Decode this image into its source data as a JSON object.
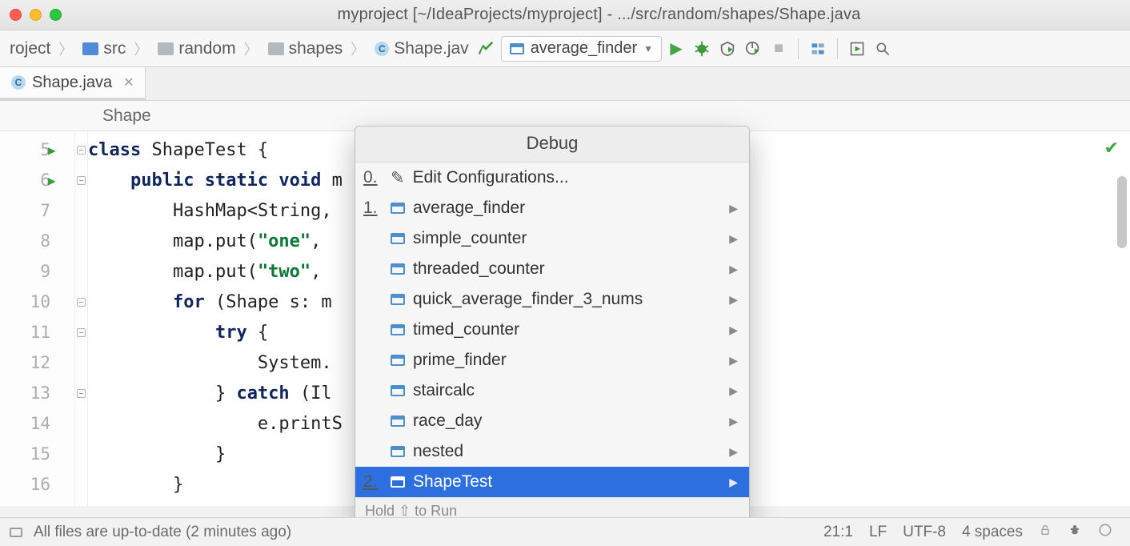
{
  "title": "myproject [~/IdeaProjects/myproject] - .../src/random/shapes/Shape.java",
  "breadcrumbs": {
    "items": [
      "roject",
      "src",
      "random",
      "shapes",
      "Shape.jav"
    ]
  },
  "run_config": {
    "selected": "average_finder"
  },
  "tab": {
    "name": "Shape.java"
  },
  "editor_crumb": "Shape",
  "gutter": {
    "lines": [
      "5",
      "6",
      "7",
      "8",
      "9",
      "10",
      "11",
      "12",
      "13",
      "14",
      "15",
      "16"
    ],
    "run_markers": [
      0,
      1
    ]
  },
  "code": {
    "lines": [
      {
        "indent": 0,
        "tokens": [
          {
            "t": "kw",
            "v": "class "
          },
          {
            "t": "plain",
            "v": "ShapeTest {"
          }
        ]
      },
      {
        "indent": 1,
        "tokens": [
          {
            "t": "kw",
            "v": "public static void "
          },
          {
            "t": "plain",
            "v": "m"
          }
        ]
      },
      {
        "indent": 2,
        "tokens": [
          {
            "t": "plain",
            "v": "HashMap<String,"
          }
        ]
      },
      {
        "indent": 2,
        "tokens": [
          {
            "t": "plain",
            "v": "map.put("
          },
          {
            "t": "str",
            "v": "\"one\""
          },
          {
            "t": "plain",
            "v": ", "
          }
        ]
      },
      {
        "indent": 2,
        "tokens": [
          {
            "t": "plain",
            "v": "map.put("
          },
          {
            "t": "str",
            "v": "\"two\""
          },
          {
            "t": "plain",
            "v": ", "
          }
        ]
      },
      {
        "indent": 2,
        "tokens": [
          {
            "t": "kw",
            "v": "for "
          },
          {
            "t": "plain",
            "v": "(Shape s: m"
          }
        ]
      },
      {
        "indent": 3,
        "tokens": [
          {
            "t": "kw",
            "v": "try "
          },
          {
            "t": "plain",
            "v": "{"
          }
        ]
      },
      {
        "indent": 4,
        "tokens": [
          {
            "t": "plain",
            "v": "System."
          }
        ]
      },
      {
        "indent": 3,
        "tokens": [
          {
            "t": "plain",
            "v": "} "
          },
          {
            "t": "kw",
            "v": "catch "
          },
          {
            "t": "plain",
            "v": "(Il"
          }
        ]
      },
      {
        "indent": 4,
        "tokens": [
          {
            "t": "plain",
            "v": "e.printS"
          }
        ]
      },
      {
        "indent": 3,
        "tokens": [
          {
            "t": "plain",
            "v": "}"
          }
        ]
      },
      {
        "indent": 2,
        "tokens": [
          {
            "t": "plain",
            "v": "}"
          }
        ]
      }
    ]
  },
  "popup": {
    "title": "Debug",
    "edit_label": "Edit Configurations...",
    "edit_num": "0.",
    "items": [
      {
        "num": "1.",
        "label": "average_finder",
        "selected": false
      },
      {
        "num": "",
        "label": "simple_counter",
        "selected": false
      },
      {
        "num": "",
        "label": "threaded_counter",
        "selected": false
      },
      {
        "num": "",
        "label": "quick_average_finder_3_nums",
        "selected": false
      },
      {
        "num": "",
        "label": "timed_counter",
        "selected": false
      },
      {
        "num": "",
        "label": "prime_finder",
        "selected": false
      },
      {
        "num": "",
        "label": "staircalc",
        "selected": false
      },
      {
        "num": "",
        "label": "race_day",
        "selected": false
      },
      {
        "num": "",
        "label": "nested",
        "selected": false
      },
      {
        "num": "2.",
        "label": "ShapeTest",
        "selected": true
      }
    ],
    "hint": "Hold ⇧ to Run"
  },
  "status": {
    "msg": "All files are up-to-date (2 minutes ago)",
    "pos": "21:1",
    "sep": "LF",
    "enc": "UTF-8",
    "indent": "4 spaces"
  }
}
